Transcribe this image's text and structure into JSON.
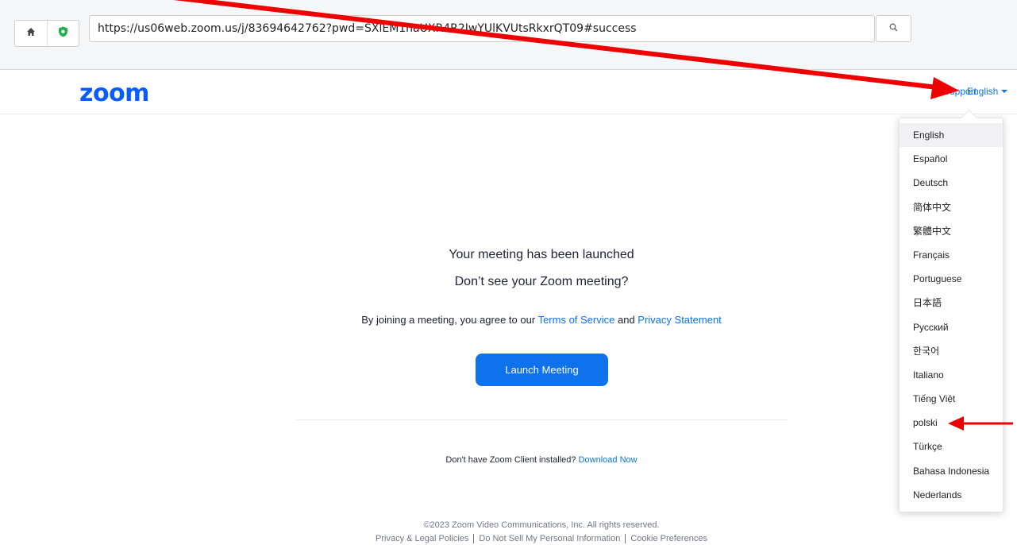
{
  "browser": {
    "url": "https://us06web.zoom.us/j/83694642762?pwd=SXlEM1haUXR4R2JwYUlKVUtsRkxrQT09#success",
    "home_icon": "home-icon",
    "shield_icon": "shield-icon",
    "search_icon": "search-icon"
  },
  "header": {
    "logo": "zoom",
    "support": "Support",
    "language": "English"
  },
  "language_menu": {
    "items": [
      "English",
      "Español",
      "Deutsch",
      "简体中文",
      "繁體中文",
      "Français",
      "Portuguese",
      "日本語",
      "Русский",
      "한국어",
      "Italiano",
      "Tiếng Việt",
      "polski",
      "Türkçe",
      "Bahasa Indonesia",
      "Nederlands"
    ]
  },
  "main": {
    "launched": "Your meeting has been launched",
    "dont_see": "Don’t see your Zoom meeting?",
    "agree_prefix": "By joining a meeting, you agree to our ",
    "terms": "Terms of Service",
    "and": " and ",
    "privacy": "Privacy Statement",
    "launch_button": "Launch Meeting",
    "no_client": "Don't have Zoom Client installed? ",
    "download": "Download Now"
  },
  "footer": {
    "copyright": "©2023 Zoom Video Communications, Inc. All rights reserved.",
    "legal": "Privacy & Legal Policies",
    "do_not_sell": "Do Not Sell My Personal Information",
    "cookie": "Cookie Preferences"
  },
  "colors": {
    "accent": "#0e72ed",
    "annotation": "#ee0000"
  }
}
